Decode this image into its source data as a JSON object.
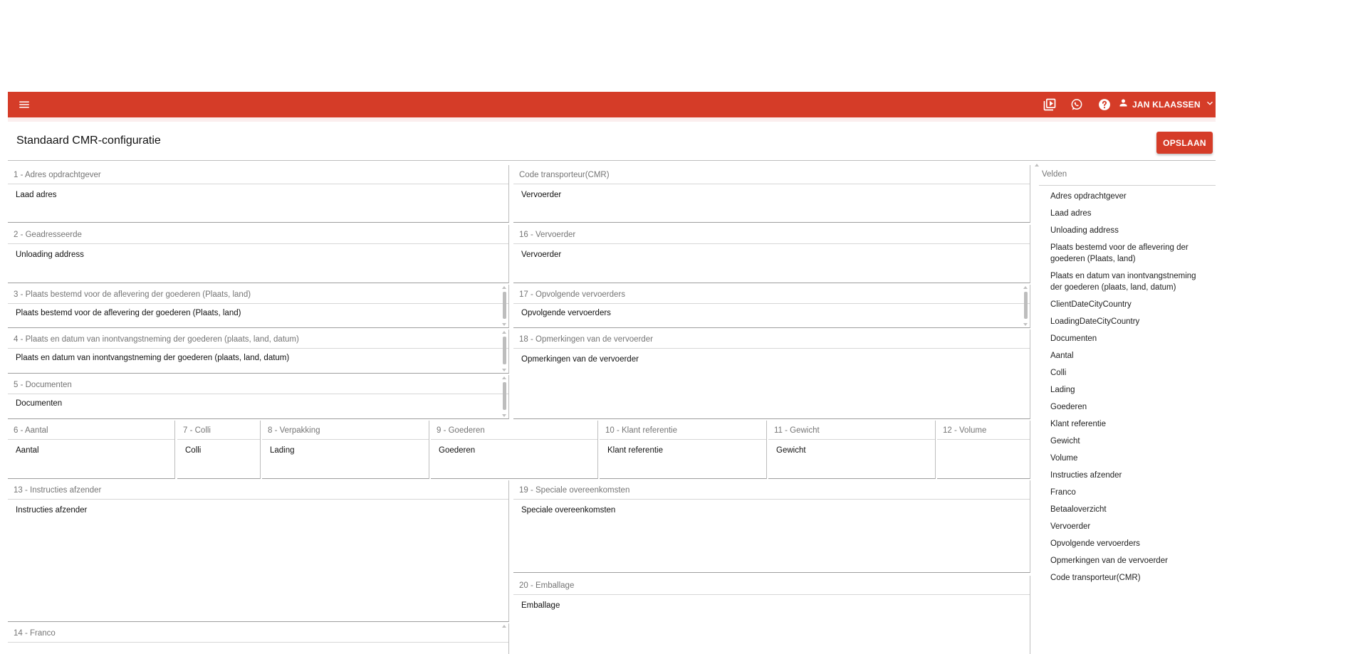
{
  "header": {
    "user_name": "JAN KLAASSEN",
    "icons": [
      "menu-icon",
      "video-library-icon",
      "whatsapp-icon",
      "help-icon",
      "person-icon",
      "chevron-down-icon"
    ],
    "accent_color": "#d53c28"
  },
  "page": {
    "title": "Standaard CMR-configuratie",
    "save_label": "OPSLAAN"
  },
  "fields": {
    "f1": {
      "label": "1 - Adres opdrachtgever",
      "value": "Laad adres"
    },
    "fcode": {
      "label": "Code transporteur(CMR)",
      "value": "Vervoerder"
    },
    "f2": {
      "label": "2 - Geadresseerde",
      "value": "Unloading address"
    },
    "f16": {
      "label": "16 - Vervoerder",
      "value": "Vervoerder"
    },
    "f3": {
      "label": "3 - Plaats bestemd voor de aflevering der goederen (Plaats, land)",
      "value": "Plaats bestemd voor de aflevering der goederen (Plaats, land)"
    },
    "f17": {
      "label": "17 - Opvolgende vervoerders",
      "value": "Opvolgende vervoerders"
    },
    "f4": {
      "label": "4 - Plaats en datum van inontvangstneming der goederen (plaats, land, datum)",
      "value": "Plaats en datum van inontvangstneming der goederen (plaats, land, datum)"
    },
    "f18": {
      "label": "18 - Opmerkingen van de vervoerder",
      "value": "Opmerkingen van de vervoerder"
    },
    "f5": {
      "label": "5 - Documenten",
      "value": "Documenten"
    },
    "f6": {
      "label": "6 - Aantal",
      "value": "Aantal"
    },
    "f7": {
      "label": "7 - Colli",
      "value": "Colli"
    },
    "f8": {
      "label": "8 - Verpakking",
      "value": "Lading"
    },
    "f9": {
      "label": "9 - Goederen",
      "value": "Goederen"
    },
    "f10": {
      "label": "10 - Klant referentie",
      "value": "Klant referentie"
    },
    "f11": {
      "label": "11 - Gewicht",
      "value": "Gewicht"
    },
    "f12": {
      "label": "12 - Volume",
      "value": ""
    },
    "f13": {
      "label": "13 - Instructies afzender",
      "value": "Instructies afzender"
    },
    "f19": {
      "label": "19 - Speciale overeenkomsten",
      "value": "Speciale overeenkomsten"
    },
    "f20": {
      "label": "20 - Emballage",
      "value": "Emballage"
    },
    "f14": {
      "label": "14 - Franco",
      "value": ""
    }
  },
  "velden": {
    "header": "Velden",
    "items": [
      "Adres opdrachtgever",
      "Laad adres",
      "Unloading address",
      "Plaats bestemd voor de aflevering der goederen (Plaats, land)",
      "Plaats en datum van inontvangstneming der goederen (plaats, land, datum)",
      "ClientDateCityCountry",
      "LoadingDateCityCountry",
      "Documenten",
      "Aantal",
      "Colli",
      "Lading",
      "Goederen",
      "Klant referentie",
      "Gewicht",
      "Volume",
      "Instructies afzender",
      "Franco",
      "Betaaloverzicht",
      "Vervoerder",
      "Opvolgende vervoerders",
      "Opmerkingen van de vervoerder",
      "Code transporteur(CMR)"
    ]
  }
}
